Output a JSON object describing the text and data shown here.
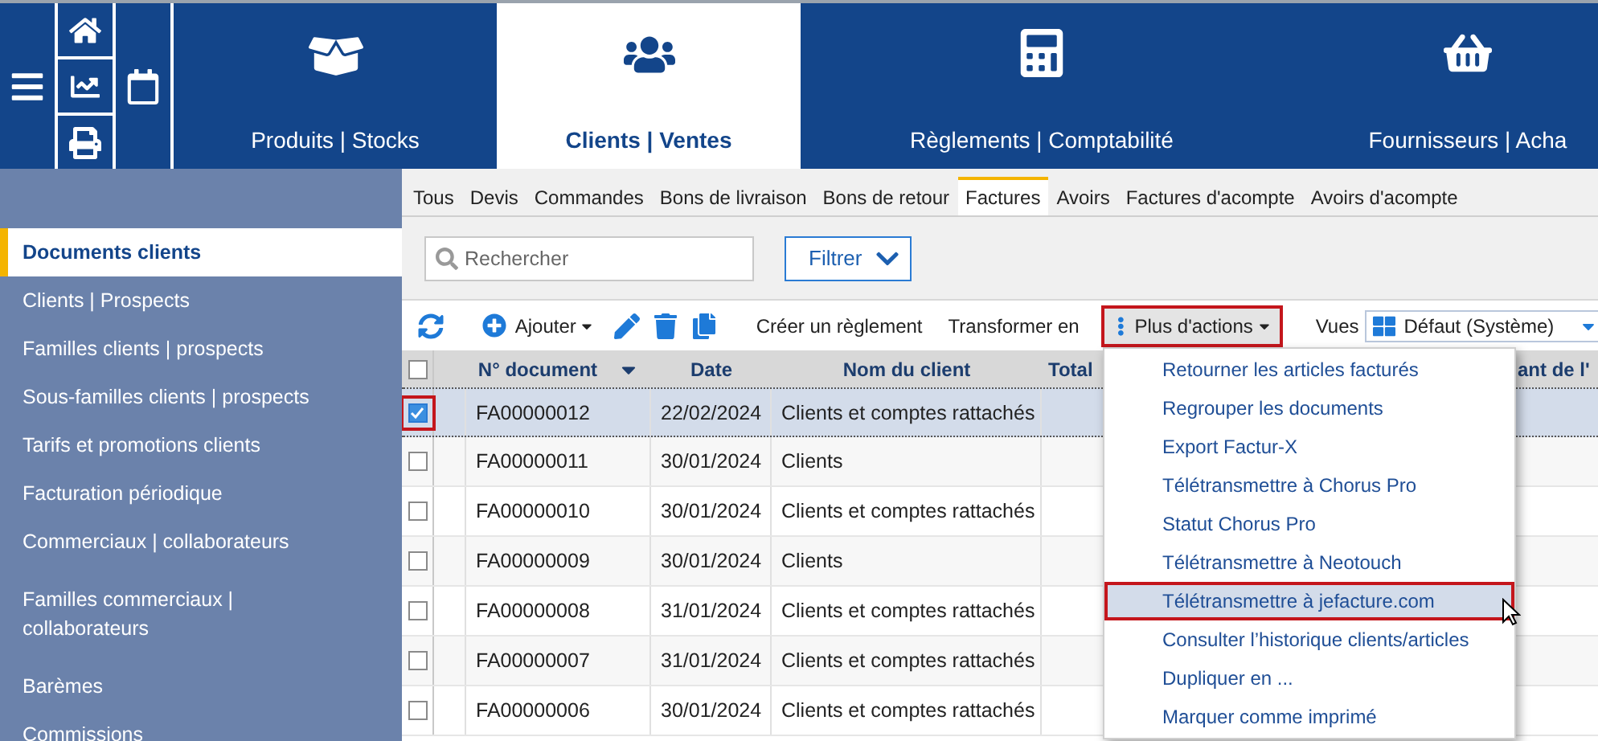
{
  "quick_icons": [
    {
      "kind": "home"
    },
    {
      "kind": "chart"
    },
    {
      "kind": "print"
    }
  ],
  "modules": [
    {
      "label": "Produits | Stocks",
      "kind": "products",
      "selected": false
    },
    {
      "label": "Clients | Ventes",
      "kind": "clients",
      "selected": true
    },
    {
      "label": "Règlements | Comptabilité",
      "kind": "accounting",
      "selected": false
    },
    {
      "label": "Fournisseurs | Acha",
      "kind": "suppliers",
      "selected": false
    }
  ],
  "sidebar": {
    "items": [
      {
        "label": "Documents clients",
        "selected": true
      },
      {
        "label": "Clients | Prospects",
        "selected": false
      },
      {
        "label": "Familles clients | prospects",
        "selected": false
      },
      {
        "label": "Sous-familles clients | prospects",
        "selected": false
      },
      {
        "label": "Tarifs et promotions clients",
        "selected": false
      },
      {
        "label": "Facturation périodique",
        "selected": false
      },
      {
        "label": "Commerciaux | collaborateurs",
        "selected": false
      },
      {
        "label": "Familles commerciaux | collaborateurs",
        "selected": false
      },
      {
        "label": "Barèmes",
        "selected": false
      },
      {
        "label": "Commissions",
        "selected": false
      }
    ]
  },
  "tabs": [
    {
      "label": "Tous",
      "selected": false
    },
    {
      "label": "Devis",
      "selected": false
    },
    {
      "label": "Commandes",
      "selected": false
    },
    {
      "label": "Bons de livraison",
      "selected": false
    },
    {
      "label": "Bons de retour",
      "selected": false
    },
    {
      "label": "Factures",
      "selected": true
    },
    {
      "label": "Avoirs",
      "selected": false
    },
    {
      "label": "Factures d'acompte",
      "selected": false
    },
    {
      "label": "Avoirs d'acompte",
      "selected": false
    }
  ],
  "search": {
    "placeholder": "Rechercher"
  },
  "filter_button": "Filtrer",
  "toolbar": {
    "add": "Ajouter",
    "create_payment": "Créer un règlement",
    "transform": "Transformer en",
    "more_actions": {
      "label": "Plus d'actions",
      "highlighted": true
    },
    "views_label": "Vues",
    "view_value": "Défaut (Système)"
  },
  "table": {
    "select_all_checked": false,
    "columns": [
      "N° document",
      "Date",
      "Nom du client",
      "Total",
      "ant de l'"
    ],
    "rows": [
      {
        "number": "FA00000012",
        "date": "22/02/2024",
        "client": "Clients et comptes rattachés",
        "checked": true,
        "highlighted": true
      },
      {
        "number": "FA00000011",
        "date": "30/01/2024",
        "client": "Clients",
        "checked": false,
        "highlighted": false
      },
      {
        "number": "FA00000010",
        "date": "30/01/2024",
        "client": "Clients et comptes rattachés",
        "checked": false,
        "highlighted": false
      },
      {
        "number": "FA00000009",
        "date": "30/01/2024",
        "client": "Clients",
        "checked": false,
        "highlighted": false
      },
      {
        "number": "FA00000008",
        "date": "31/01/2024",
        "client": "Clients et comptes rattachés",
        "checked": false,
        "highlighted": false
      },
      {
        "number": "FA00000007",
        "date": "31/01/2024",
        "client": "Clients et comptes rattachés",
        "checked": false,
        "highlighted": false
      },
      {
        "number": "FA00000006",
        "date": "30/01/2024",
        "client": "Clients et comptes rattachés",
        "checked": false,
        "highlighted": false
      }
    ]
  },
  "actions_menu": {
    "items": [
      {
        "label": "Retourner les articles facturés",
        "highlighted": false
      },
      {
        "label": "Regrouper les documents",
        "highlighted": false
      },
      {
        "label": "Export Factur-X",
        "highlighted": false
      },
      {
        "label": "Télétransmettre à Chorus Pro",
        "highlighted": false
      },
      {
        "label": "Statut Chorus Pro",
        "highlighted": false
      },
      {
        "label": "Télétransmettre à Neotouch",
        "highlighted": false
      },
      {
        "label": "Télétransmettre à jefacture.com",
        "highlighted": true
      },
      {
        "label": "Consulter l’historique clients/articles",
        "highlighted": false
      },
      {
        "label": "Dupliquer en ...",
        "highlighted": false
      },
      {
        "label": "Marquer comme imprimé",
        "highlighted": false
      }
    ]
  }
}
